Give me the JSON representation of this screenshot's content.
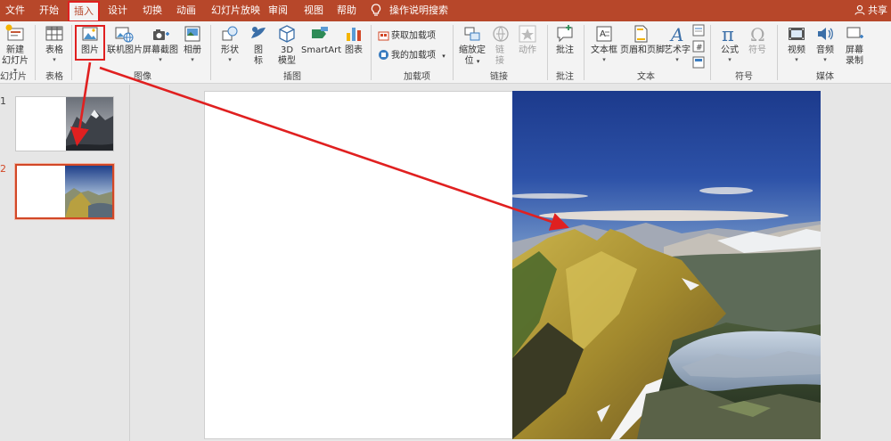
{
  "menu": {
    "items": [
      {
        "id": "file",
        "label": "文件"
      },
      {
        "id": "home",
        "label": "开始"
      },
      {
        "id": "insert",
        "label": "插入",
        "active": true
      },
      {
        "id": "design",
        "label": "设计"
      },
      {
        "id": "transitions",
        "label": "切换"
      },
      {
        "id": "animations",
        "label": "动画"
      },
      {
        "id": "slideshow",
        "label": "幻灯片放映"
      },
      {
        "id": "review",
        "label": "审阅"
      },
      {
        "id": "view",
        "label": "视图"
      },
      {
        "id": "help",
        "label": "帮助"
      }
    ],
    "tell_me": "操作说明搜索",
    "share": "共享"
  },
  "ribbon": {
    "slides": {
      "new_slide_l1": "新建",
      "new_slide_l2": "幻灯片",
      "group": "幻灯片"
    },
    "tables": {
      "table": "表格",
      "group": "表格"
    },
    "images": {
      "picture": "图片",
      "online_picture": "联机图片",
      "screenshot": "屏幕截图",
      "album": "相册",
      "group": "图像"
    },
    "illustrations": {
      "shapes": "形状",
      "icons_l1": "图",
      "icons_l2": "标",
      "model_l1": "3D",
      "model_l2": "模型",
      "smartart": "SmartArt",
      "chart": "图表",
      "group": "插图"
    },
    "addins": {
      "get": "获取加载项",
      "my": "我的加载项",
      "group": "加载项"
    },
    "links": {
      "zoom_l1": "缩放定",
      "zoom_l2": "位",
      "link_l1": "链",
      "link_l2": "接",
      "action": "动作",
      "group": "链接"
    },
    "comments": {
      "comment": "批注",
      "group": "批注"
    },
    "text": {
      "textbox": "文本框",
      "header_footer": "页眉和页脚",
      "wordart": "艺术字",
      "group": "文本"
    },
    "symbols": {
      "equation": "公式",
      "symbol": "符号",
      "group": "符号"
    },
    "media": {
      "video": "视频",
      "audio": "音频",
      "record_l1": "屏幕",
      "record_l2": "录制",
      "group": "媒体"
    }
  },
  "thumbnails": [
    {
      "number": "1",
      "selected": false
    },
    {
      "number": "2",
      "selected": true
    }
  ],
  "colors": {
    "accent": "#b7472a",
    "annotation": "#e02020",
    "selection": "#d24726"
  }
}
